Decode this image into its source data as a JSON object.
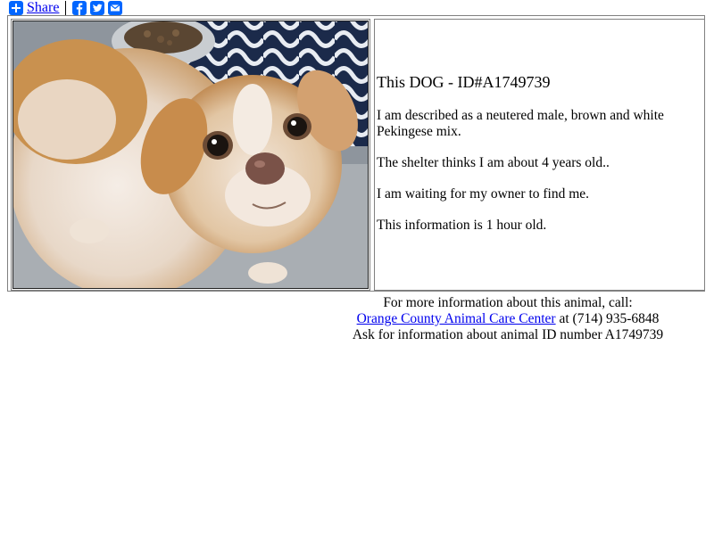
{
  "share": {
    "label": "Share",
    "icons": [
      "plus-icon",
      "facebook-icon",
      "twitter-icon",
      "email-icon"
    ]
  },
  "animal": {
    "title": "This DOG - ID#A1749739",
    "description": "I am described as a neutered male, brown and white Pekingese mix.",
    "age": "The shelter thinks I am about 4 years old..",
    "status": "I am waiting for my owner to find me.",
    "freshness": "This information is 1 hour old."
  },
  "footer": {
    "line1": "For more information about this animal, call:",
    "center_name": "Orange County Animal Care Center",
    "phone": " at (714) 935-6848",
    "line3": "Ask for information about animal ID number A1749739"
  },
  "colors": {
    "link": "#0000ee",
    "share_blue": "#0166ff"
  }
}
